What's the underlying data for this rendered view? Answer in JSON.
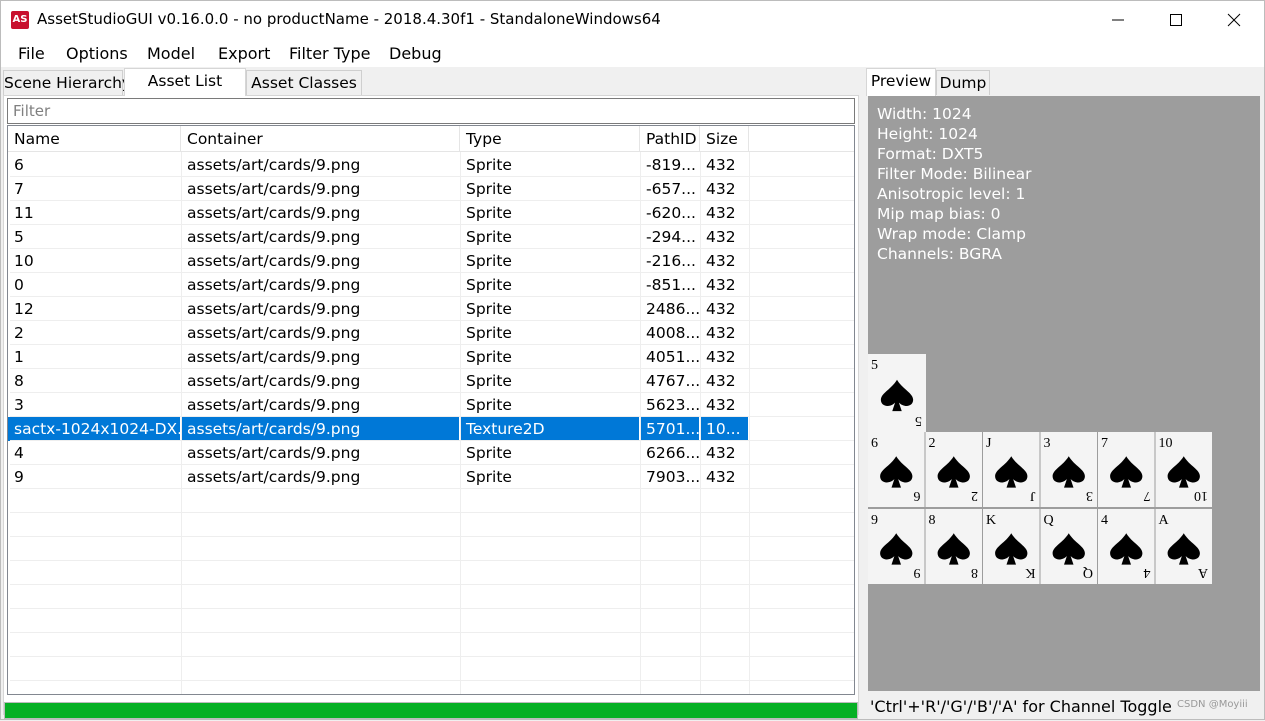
{
  "window": {
    "title": "AssetStudioGUI v0.16.0.0 - no productName - 2018.4.30f1 - StandaloneWindows64",
    "app_icon_text": "AS"
  },
  "menu": [
    "File",
    "Options",
    "Model",
    "Export",
    "Filter Type",
    "Debug"
  ],
  "left_tabs": [
    "Scene Hierarchy",
    "Asset List",
    "Asset Classes"
  ],
  "filter": {
    "placeholder": "Filter",
    "value": ""
  },
  "asset_list": {
    "columns": [
      "Name",
      "Container",
      "Type",
      "PathID",
      "Size"
    ],
    "rows": [
      [
        "6",
        "assets/art/cards/9.png",
        "Sprite",
        "-819...",
        "432"
      ],
      [
        "7",
        "assets/art/cards/9.png",
        "Sprite",
        "-657...",
        "432"
      ],
      [
        "11",
        "assets/art/cards/9.png",
        "Sprite",
        "-620...",
        "432"
      ],
      [
        "5",
        "assets/art/cards/9.png",
        "Sprite",
        "-294...",
        "432"
      ],
      [
        "10",
        "assets/art/cards/9.png",
        "Sprite",
        "-216...",
        "432"
      ],
      [
        "0",
        "assets/art/cards/9.png",
        "Sprite",
        "-851...",
        "432"
      ],
      [
        "12",
        "assets/art/cards/9.png",
        "Sprite",
        "2486...",
        "432"
      ],
      [
        "2",
        "assets/art/cards/9.png",
        "Sprite",
        "4008...",
        "432"
      ],
      [
        "1",
        "assets/art/cards/9.png",
        "Sprite",
        "4051...",
        "432"
      ],
      [
        "8",
        "assets/art/cards/9.png",
        "Sprite",
        "4767...",
        "432"
      ],
      [
        "3",
        "assets/art/cards/9.png",
        "Sprite",
        "5623...",
        "432"
      ],
      [
        "sactx-1024x1024-DX...",
        "assets/art/cards/9.png",
        "Texture2D",
        "5701...",
        "10..."
      ],
      [
        "4",
        "assets/art/cards/9.png",
        "Sprite",
        "6266...",
        "432"
      ],
      [
        "9",
        "assets/art/cards/9.png",
        "Sprite",
        "7903...",
        "432"
      ]
    ],
    "selected_index": 11
  },
  "progress_fraction": 1.0,
  "right_tabs": [
    "Preview",
    "Dump"
  ],
  "texture_info": [
    "Width: 1024",
    "Height: 1024",
    "Format: DXT5",
    "Filter Mode: Bilinear",
    "Anisotropic level: 1",
    "Mip map bias: 0",
    "Wrap mode: Clamp",
    "Channels: BGRA"
  ],
  "atlas_cards": {
    "top": [
      "5"
    ],
    "row1": [
      "6",
      "2",
      "J",
      "3",
      "7",
      "10"
    ],
    "row2": [
      "9",
      "8",
      "K",
      "Q",
      "4",
      "A"
    ]
  },
  "status_text": "'Ctrl'+'R'/'G'/'B'/'A' for Channel Toggle",
  "watermark": "CSDN @Moyiii",
  "colors": {
    "selection": "#0078d7",
    "progress": "#06b025",
    "preview_bg": "#9d9d9d"
  }
}
